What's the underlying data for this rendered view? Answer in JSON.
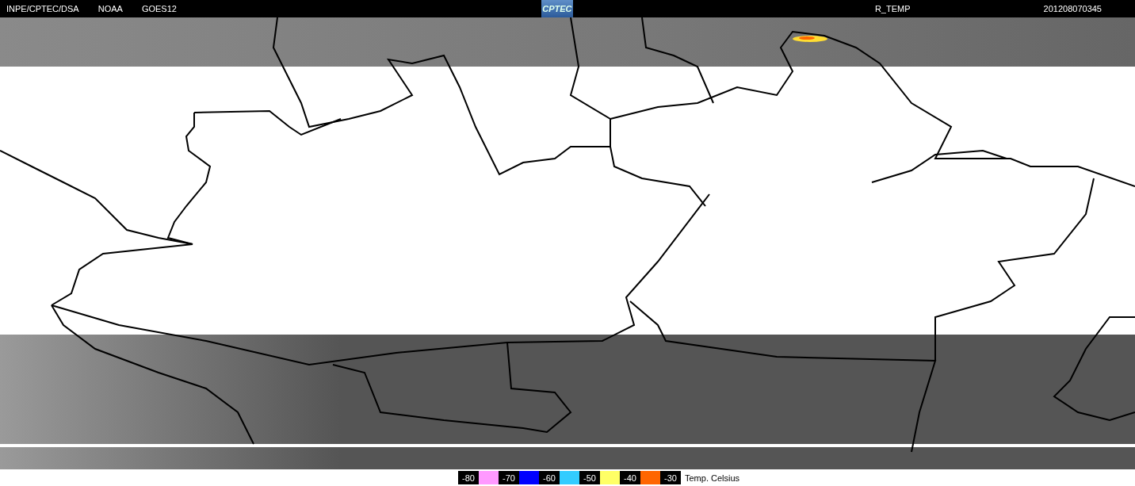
{
  "header": {
    "source": "INPE/CPTEC/DSA",
    "agency": "NOAA",
    "satellite": "GOES12",
    "logo": "CPTEC",
    "product": "R_TEMP",
    "timestamp": "201208070345"
  },
  "legend": {
    "items": [
      {
        "label": "-80",
        "color": "#ff99ff"
      },
      {
        "label": "-70",
        "color": "#0000ff"
      },
      {
        "label": "-60",
        "color": "#33ccff"
      },
      {
        "label": "-50",
        "color": "#ffff66"
      },
      {
        "label": "-40",
        "color": "#ff6600"
      },
      {
        "label": "-30"
      }
    ],
    "title": "Temp. Celsius"
  }
}
